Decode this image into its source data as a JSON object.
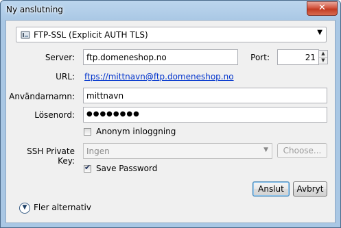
{
  "window": {
    "title": "Ny anslutning",
    "close_label": "✕"
  },
  "protocol": {
    "selected": "FTP-SSL (Explicit AUTH TLS)"
  },
  "server": {
    "label": "Server:",
    "value": "ftp.domeneshop.no"
  },
  "port": {
    "label": "Port:",
    "value": "21"
  },
  "url": {
    "label": "URL:",
    "value": "ftps://mittnavn@ftp.domeneshop.no"
  },
  "username": {
    "label": "Användarnamn:",
    "value": "mittnavn"
  },
  "password": {
    "label": "Lösenord:",
    "value": "●●●●●●●●"
  },
  "anonymous": {
    "label": "Anonym inloggning",
    "checked": false
  },
  "ssh_key": {
    "label": "SSH Private Key:",
    "selected": "Ingen",
    "choose_label": "Choose..."
  },
  "save_password": {
    "label": "Save Password",
    "checked": true
  },
  "buttons": {
    "connect": "Anslut",
    "cancel": "Avbryt"
  },
  "more_options": {
    "label": "Fler alternativ"
  }
}
